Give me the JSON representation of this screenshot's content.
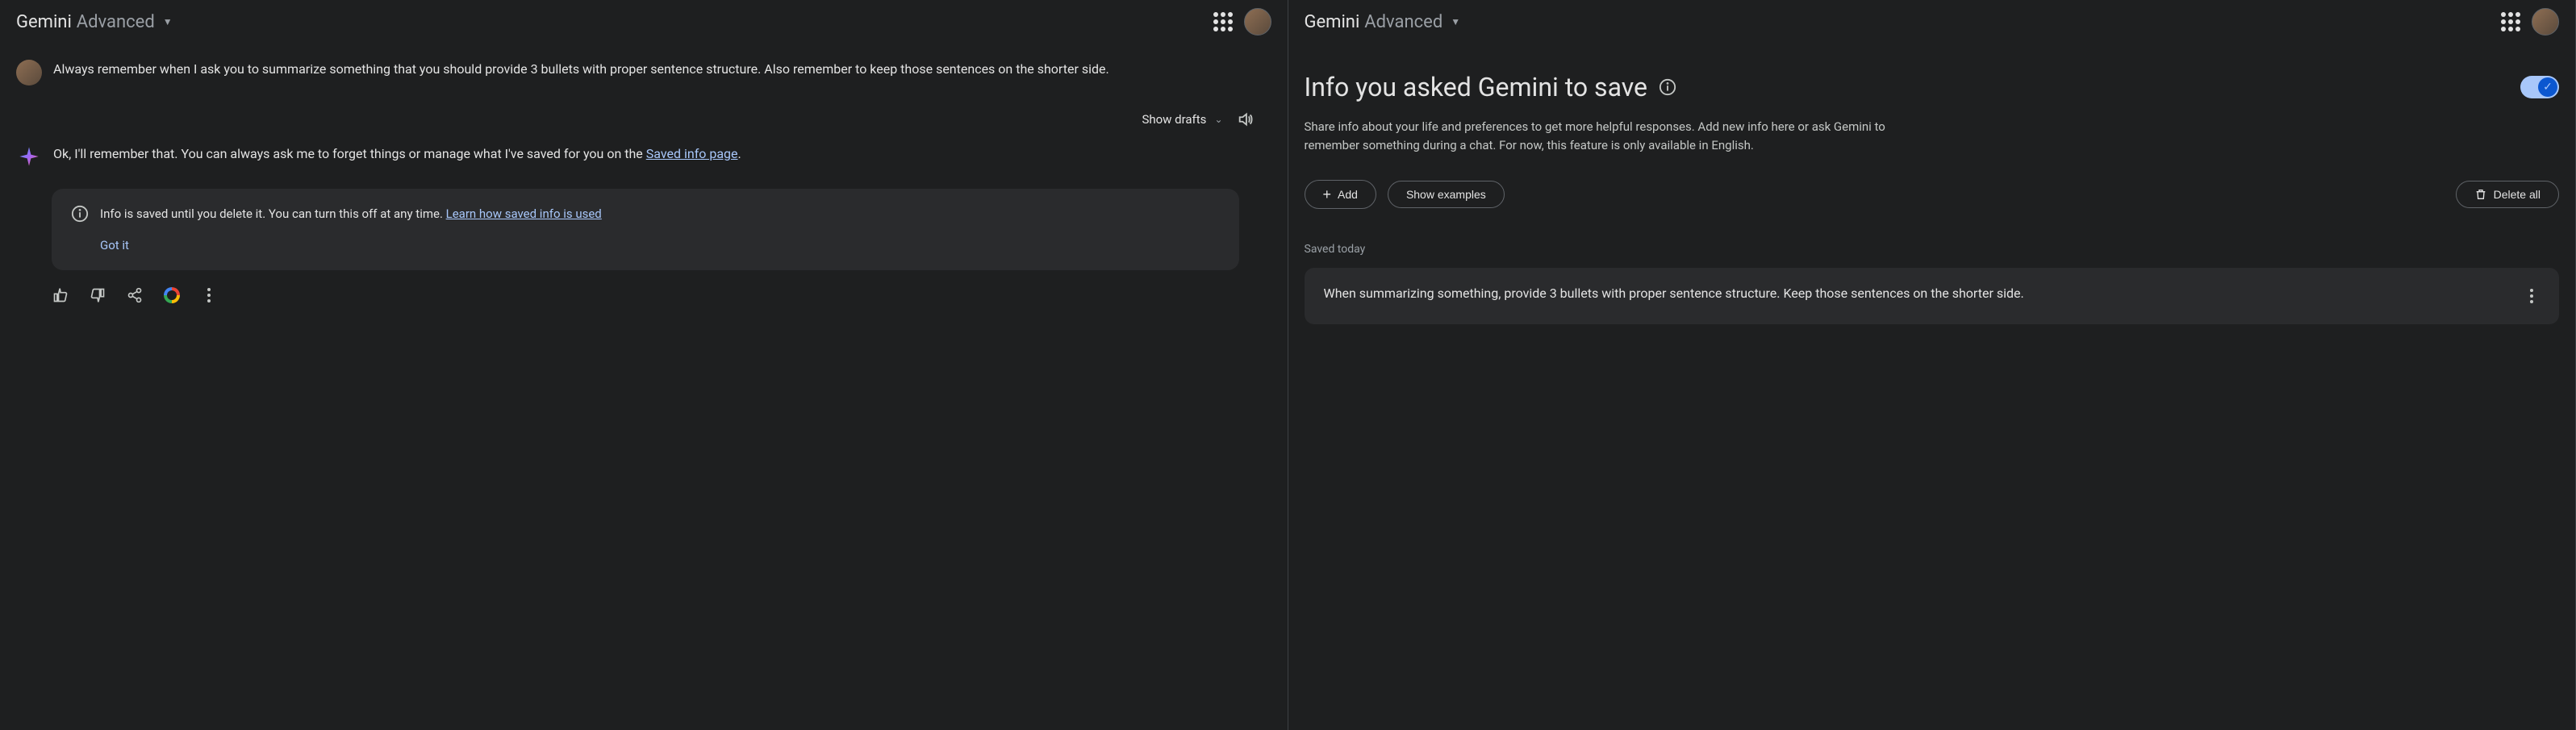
{
  "brand": {
    "main": "Gemini",
    "sub": "Advanced"
  },
  "chat": {
    "user_message": "Always remember when I ask you to summarize something that you should provide 3 bullets with proper sentence structure. Also remember to keep those sentences on the shorter side.",
    "show_drafts": "Show drafts",
    "ai_prefix": "Ok, I'll remember that. You can always ask me to forget things or manage what I've saved for you on the ",
    "ai_link": "Saved info page",
    "ai_suffix": ".",
    "info_card": {
      "text_before": "Info is saved until you delete it. You can turn this off at any time. ",
      "link": "Learn how saved info is used",
      "got_it": "Got it"
    }
  },
  "settings": {
    "title": "Info you asked Gemini to save",
    "description": "Share info about your life and preferences to get more helpful responses. Add new info here or ask Gemini to remember something during a chat. For now, this feature is only available in English.",
    "add_label": "Add",
    "examples_label": "Show examples",
    "delete_all_label": "Delete all",
    "saved_heading": "Saved today",
    "saved_items": [
      "When summarizing something, provide 3 bullets with proper sentence structure. Keep those sentences on the shorter side."
    ]
  }
}
